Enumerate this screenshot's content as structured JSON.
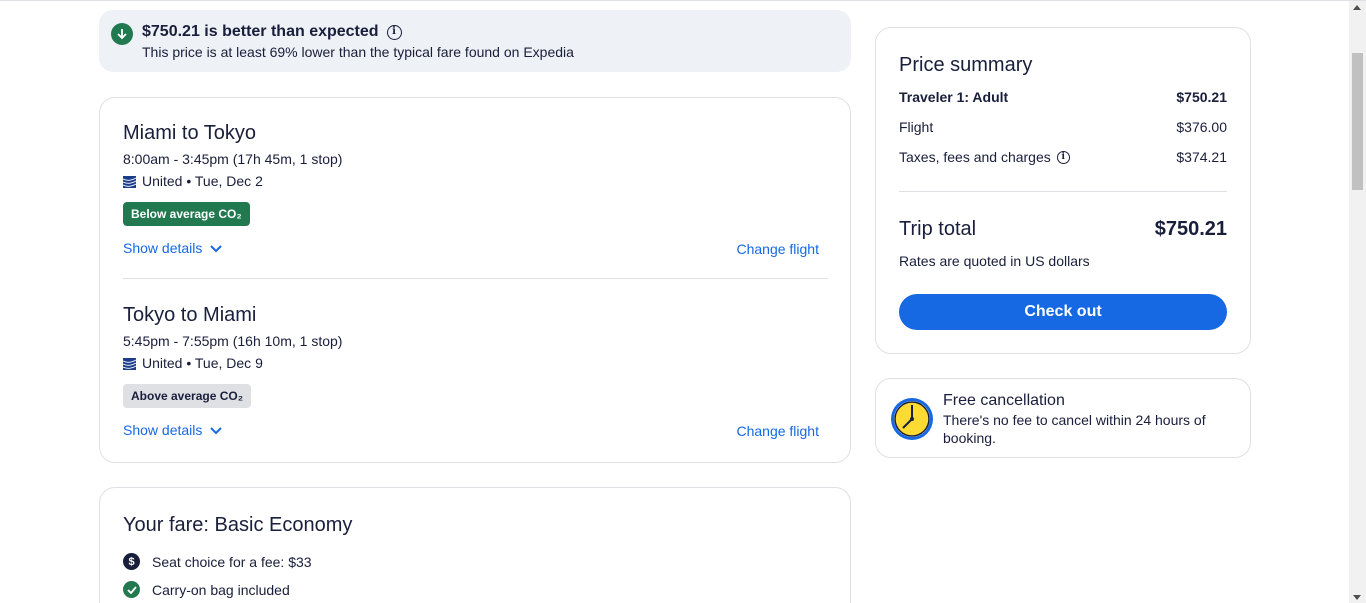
{
  "banner": {
    "title": "$750.21 is better than expected",
    "subtitle": "This price is at least 69% lower than the typical fare found on Expedia"
  },
  "flights": [
    {
      "route": "Miami to Tokyo",
      "times": "8:00am - 3:45pm (17h 45m, 1 stop)",
      "airline": "United • Tue, Dec 2",
      "co2_badge": "Below average CO₂",
      "show_details": "Show details",
      "change_flight": "Change flight"
    },
    {
      "route": "Tokyo to Miami",
      "times": "5:45pm - 7:55pm (16h 10m, 1 stop)",
      "airline": "United • Tue, Dec 9",
      "co2_badge": "Above average CO₂",
      "show_details": "Show details",
      "change_flight": "Change flight"
    }
  ],
  "fare": {
    "title": "Your fare: Basic Economy",
    "items": [
      {
        "text": "Seat choice for a fee: $33",
        "icon": "dollar-icon"
      },
      {
        "text": "Carry-on bag included",
        "icon": "check-icon"
      }
    ]
  },
  "summary": {
    "heading": "Price summary",
    "traveler_label": "Traveler 1: Adult",
    "traveler_amount": "$750.21",
    "flight_label": "Flight",
    "flight_amount": "$376.00",
    "taxes_label": "Taxes, fees and charges",
    "taxes_amount": "$374.21",
    "total_label": "Trip total",
    "total_amount": "$750.21",
    "rates_note": "Rates are quoted in US dollars",
    "checkout_label": "Check out"
  },
  "cancellation": {
    "title": "Free cancellation",
    "text": "There's no fee to cancel within 24 hours of booking."
  },
  "colors": {
    "accent": "#1668e3",
    "green": "#227950",
    "text": "#191e3b"
  }
}
